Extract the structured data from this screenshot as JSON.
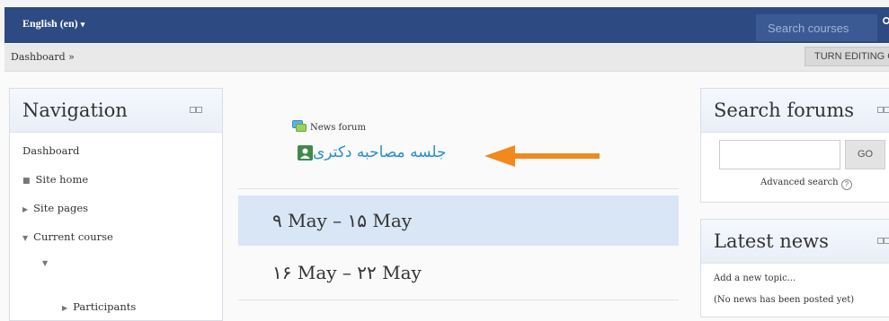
{
  "header": {
    "language": "English (en)",
    "search_placeholder": "Search courses"
  },
  "breadcrumb": {
    "dashboard": "Dashboard",
    "separator": "»",
    "turn_editing": "TURN EDITING ON"
  },
  "navigation": {
    "title": "Navigation",
    "items": [
      {
        "label": "Dashboard"
      },
      {
        "label": "Site home"
      },
      {
        "label": "Site pages"
      },
      {
        "label": "Current course"
      },
      {
        "label": ""
      },
      {
        "label": "Participants"
      }
    ]
  },
  "main": {
    "news_forum": "News forum",
    "persian_activity": "جلسه مصاحبه دکتری",
    "weeks": [
      {
        "label": "۹ May – ۱۵ May",
        "active": true
      },
      {
        "label": "۱۶ May – ۲۲ May",
        "active": false
      }
    ]
  },
  "search_forums": {
    "title": "Search forums",
    "go_label": "GO",
    "advanced": "Advanced search"
  },
  "latest_news": {
    "title": "Latest news",
    "add_topic": "Add a new topic...",
    "no_news": "(No news has been posted yet)"
  },
  "colors": {
    "topbar": "#2e4a82",
    "active_week": "#d8e6f5",
    "link_blue": "#2a8fcc",
    "arrow_orange": "#f08a1c"
  },
  "icons": [
    "chevron-down-icon",
    "search-icon",
    "block-control-icon",
    "forum-icon",
    "activity-icon",
    "orange-arrow-icon",
    "help-icon"
  ]
}
